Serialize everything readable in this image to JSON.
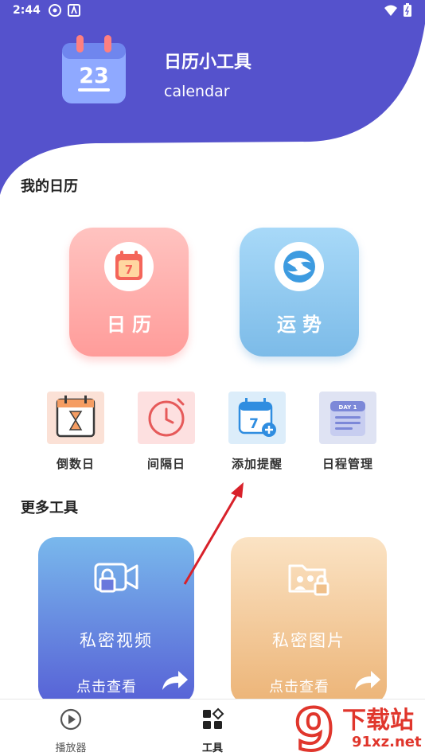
{
  "status_bar": {
    "time": "2:44"
  },
  "header": {
    "app_title": "日历小工具",
    "app_subtitle": "calendar",
    "app_icon_date": "23"
  },
  "my_calendar": {
    "section_title": "我的日历",
    "cards": [
      {
        "label": "日历",
        "icon": "calendar-icon",
        "icon_text": "7"
      },
      {
        "label": "运势",
        "icon": "fortune-icon"
      }
    ]
  },
  "tools": [
    {
      "label": "倒数日",
      "icon": "hourglass-calendar-icon"
    },
    {
      "label": "间隔日",
      "icon": "clock-icon"
    },
    {
      "label": "添加提醒",
      "icon": "add-reminder-icon",
      "icon_text": "7"
    },
    {
      "label": "日程管理",
      "icon": "schedule-icon",
      "icon_text": "DAY 1"
    }
  ],
  "more_tools": {
    "section_title": "更多工具",
    "cards": [
      {
        "title": "私密视频",
        "action": "点击查看",
        "icon": "locked-video-icon"
      },
      {
        "title": "私密图片",
        "action": "点击查看",
        "icon": "locked-photo-icon"
      }
    ]
  },
  "bottom_nav": [
    {
      "label": "播放器",
      "icon": "play-icon",
      "active": false
    },
    {
      "label": "工具",
      "icon": "tools-grid-icon",
      "active": true
    }
  ],
  "watermark": {
    "brand_number": "9",
    "name": "下载站",
    "domain": "91xz.net"
  },
  "colors": {
    "primary": "#5552CC",
    "calendar_card": "#ff9c9a",
    "fortune_card": "#7cbbe8",
    "video_card": "#5761d6",
    "photo_card": "#ecb477",
    "annotation_arrow": "#d8212a"
  }
}
